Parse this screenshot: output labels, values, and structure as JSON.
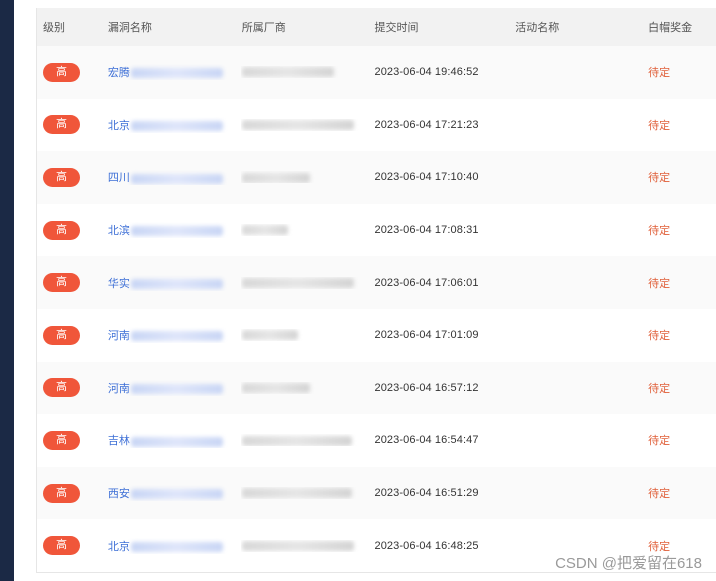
{
  "table": {
    "headers": [
      "级别",
      "漏洞名称",
      "所属厂商",
      "提交时间",
      "活动名称",
      "白帽奖金"
    ],
    "rows": [
      {
        "level": "高",
        "name_prefix": "宏腾",
        "vendor_w": 92,
        "time": "2023-06-04 19:46:52",
        "activity": "",
        "bounty": "待定"
      },
      {
        "level": "高",
        "name_prefix": "北京",
        "vendor_w": 112,
        "time": "2023-06-04 17:21:23",
        "activity": "",
        "bounty": "待定"
      },
      {
        "level": "高",
        "name_prefix": "四川",
        "vendor_w": 68,
        "time": "2023-06-04 17:10:40",
        "activity": "",
        "bounty": "待定"
      },
      {
        "level": "高",
        "name_prefix": "北滨",
        "vendor_w": 46,
        "time": "2023-06-04 17:08:31",
        "activity": "",
        "bounty": "待定"
      },
      {
        "level": "高",
        "name_prefix": "华实",
        "vendor_w": 112,
        "time": "2023-06-04 17:06:01",
        "activity": "",
        "bounty": "待定"
      },
      {
        "level": "高",
        "name_prefix": "河南",
        "vendor_w": 56,
        "time": "2023-06-04 17:01:09",
        "activity": "",
        "bounty": "待定"
      },
      {
        "level": "高",
        "name_prefix": "河南",
        "vendor_w": 68,
        "time": "2023-06-04 16:57:12",
        "activity": "",
        "bounty": "待定"
      },
      {
        "level": "高",
        "name_prefix": "吉林",
        "vendor_w": 110,
        "time": "2023-06-04 16:54:47",
        "activity": "",
        "bounty": "待定"
      },
      {
        "level": "高",
        "name_prefix": "西安",
        "vendor_w": 110,
        "time": "2023-06-04 16:51:29",
        "activity": "",
        "bounty": "待定"
      },
      {
        "level": "高",
        "name_prefix": "北京",
        "vendor_w": 112,
        "time": "2023-06-04 16:48:25",
        "activity": "",
        "bounty": "待定"
      }
    ]
  },
  "watermark": "CSDN @把爱留在618",
  "colors": {
    "badge": "#f0563a",
    "link": "#3d6fd6",
    "bounty": "#e0603a",
    "sidebar": "#1b2945"
  }
}
